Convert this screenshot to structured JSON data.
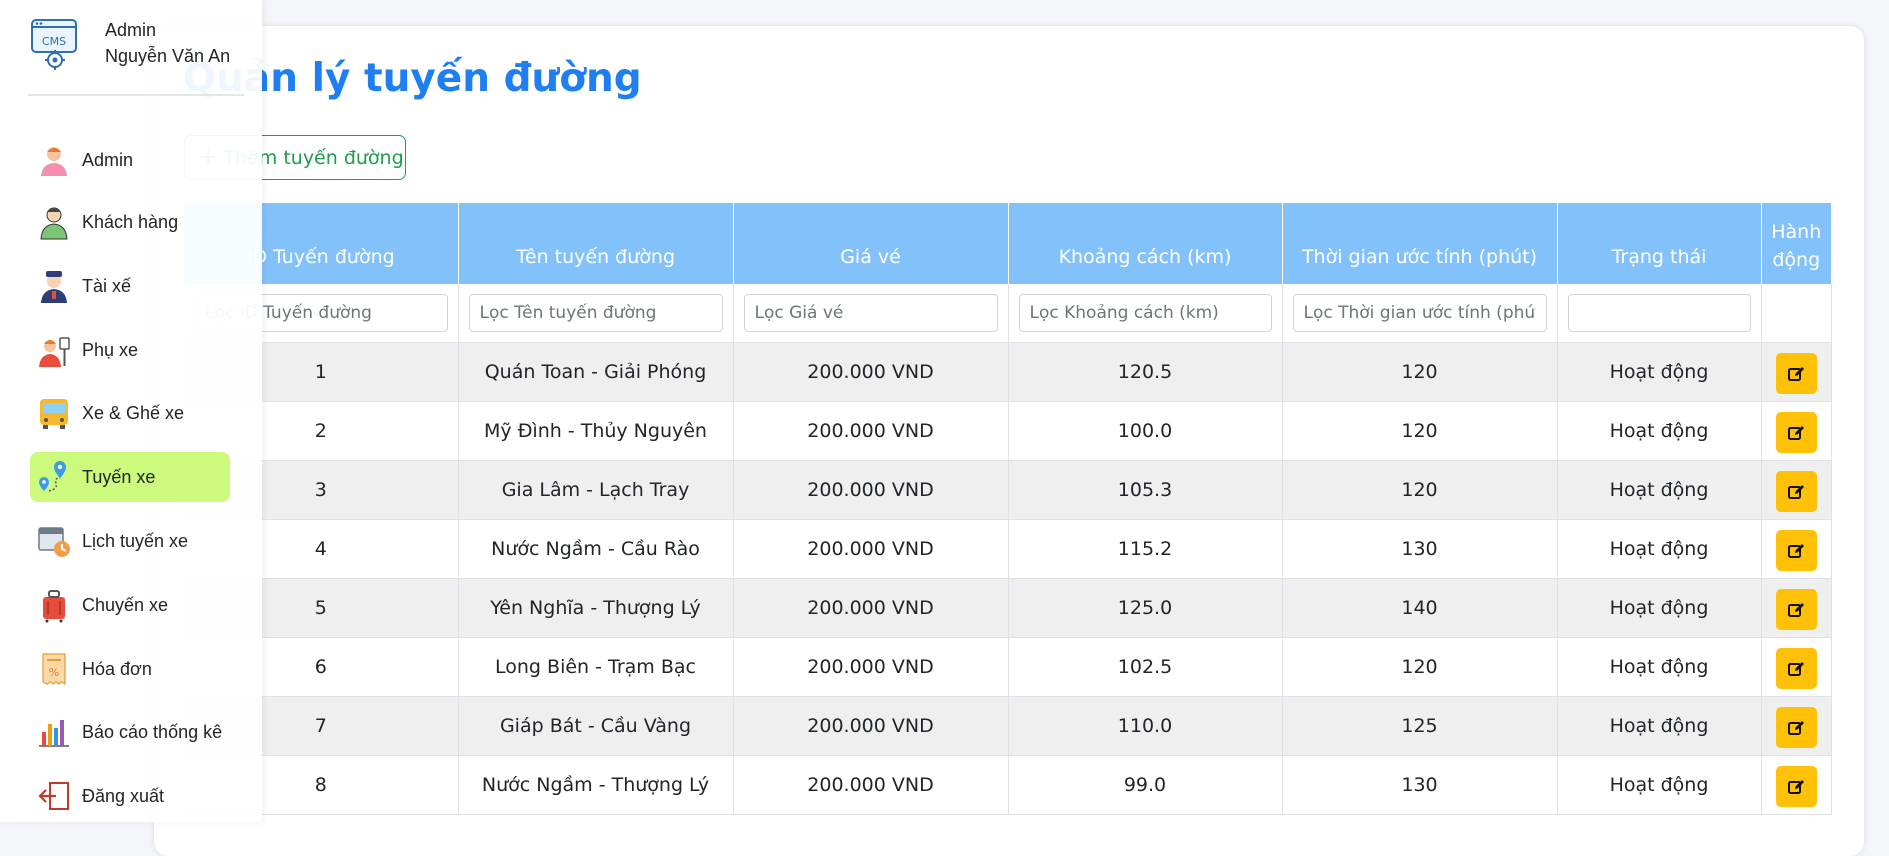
{
  "profile": {
    "logo_text": "CMS",
    "role": "Admin",
    "name": "Nguyễn Văn An"
  },
  "sidebar": {
    "items": [
      {
        "label": "Admin",
        "icon": "admin-user-icon",
        "active": false
      },
      {
        "label": "Khách hàng",
        "icon": "customer-icon",
        "active": false
      },
      {
        "label": "Tài xế",
        "icon": "driver-icon",
        "active": false
      },
      {
        "label": "Phụ xe",
        "icon": "assistant-icon",
        "active": false
      },
      {
        "label": "Xe & Ghế xe",
        "icon": "bus-icon",
        "active": false
      },
      {
        "label": "Tuyến xe",
        "icon": "route-map-icon",
        "active": true
      },
      {
        "label": "Lịch tuyến xe",
        "icon": "calendar-clock-icon",
        "active": false
      },
      {
        "label": "Chuyến xe",
        "icon": "luggage-icon",
        "active": false
      },
      {
        "label": "Hóa đơn",
        "icon": "invoice-icon",
        "active": false
      },
      {
        "label": "Báo cáo thống kê",
        "icon": "bar-chart-icon",
        "active": false
      },
      {
        "label": "Đăng xuất",
        "icon": "logout-icon",
        "active": false
      }
    ]
  },
  "main": {
    "title": "Quản lý tuyến đường",
    "add_button": "Thêm tuyến đường"
  },
  "table": {
    "headers": [
      "ID Tuyến đường",
      "Tên tuyến đường",
      "Giá vé",
      "Khoảng cách (km)",
      "Thời gian ước tính (phút)",
      "Trạng thái",
      "Hành động"
    ],
    "filters": [
      "Lọc ID Tuyến đường",
      "Lọc Tên tuyến đường",
      "Lọc Giá vé",
      "Lọc Khoảng cách (km)",
      "Lọc Thời gian ước tính (phút)"
    ],
    "rows": [
      {
        "id": "1",
        "name": "Quán Toan - Giải Phóng",
        "price": "200.000 VND",
        "distance": "120.5",
        "time": "120",
        "status": "Hoạt động"
      },
      {
        "id": "2",
        "name": "Mỹ Đình - Thủy Nguyên",
        "price": "200.000 VND",
        "distance": "100.0",
        "time": "120",
        "status": "Hoạt động"
      },
      {
        "id": "3",
        "name": "Gia Lâm - Lạch Tray",
        "price": "200.000 VND",
        "distance": "105.3",
        "time": "120",
        "status": "Hoạt động"
      },
      {
        "id": "4",
        "name": "Nước Ngầm - Cầu Rào",
        "price": "200.000 VND",
        "distance": "115.2",
        "time": "130",
        "status": "Hoạt động"
      },
      {
        "id": "5",
        "name": "Yên Nghĩa - Thượng Lý",
        "price": "200.000 VND",
        "distance": "125.0",
        "time": "140",
        "status": "Hoạt động"
      },
      {
        "id": "6",
        "name": "Long Biên - Trạm Bạc",
        "price": "200.000 VND",
        "distance": "102.5",
        "time": "120",
        "status": "Hoạt động"
      },
      {
        "id": "7",
        "name": "Giáp Bát - Cầu Vàng",
        "price": "200.000 VND",
        "distance": "110.0",
        "time": "125",
        "status": "Hoạt động"
      },
      {
        "id": "8",
        "name": "Nước Ngầm - Thượng Lý",
        "price": "200.000 VND",
        "distance": "99.0",
        "time": "130",
        "status": "Hoạt động"
      }
    ]
  },
  "colors": {
    "title": "#1f7ff0",
    "header_bg": "#83c1fb",
    "add_button": "#1f9a4e",
    "edit_button": "#ffc107",
    "active_nav": "#ccfa7d"
  }
}
